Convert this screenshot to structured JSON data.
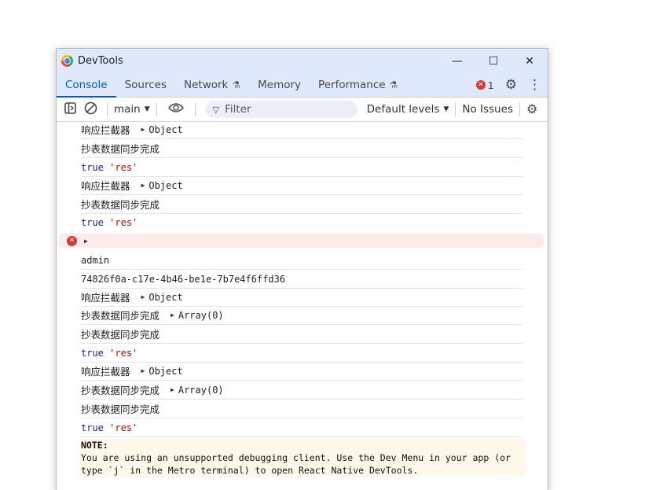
{
  "window": {
    "title": "DevTools"
  },
  "titlebar_buttons": {
    "minimize": "—",
    "maximize": "☐",
    "close": "✕"
  },
  "tabs": [
    {
      "label": "Console",
      "active": true,
      "experimental": false
    },
    {
      "label": "Sources",
      "active": false,
      "experimental": false
    },
    {
      "label": "Network",
      "active": false,
      "experimental": true
    },
    {
      "label": "Memory",
      "active": false,
      "experimental": false
    },
    {
      "label": "Performance",
      "active": false,
      "experimental": true
    }
  ],
  "error_count": "1",
  "toolbar": {
    "context": "main",
    "filter_placeholder": "Filter",
    "levels": "Default levels",
    "issues": "No Issues"
  },
  "log": [
    {
      "text": "响应拦截器",
      "object": "Object"
    },
    {
      "text": "抄表数据同步完成",
      "object": ""
    },
    {
      "kw": "true",
      "str": "'res'"
    },
    {
      "text": "响应拦截器",
      "object": "Object"
    },
    {
      "text": "抄表数据同步完成",
      "object": ""
    },
    {
      "kw": "true",
      "str": "'res'"
    },
    {
      "text": "admin"
    },
    {
      "text": "74826f0a-c17e-4b46-be1e-7b7e4f6ffd36"
    },
    {
      "text": "响应拦截器",
      "object": "Object"
    },
    {
      "text": "抄表数据同步完成",
      "object": "Array(0)"
    },
    {
      "text": "抄表数据同步完成",
      "object": ""
    },
    {
      "kw": "true",
      "str": "'res'"
    },
    {
      "text": "响应拦截器",
      "object": "Object"
    },
    {
      "text": "抄表数据同步完成",
      "object": "Array(0)"
    },
    {
      "text": "抄表数据同步完成",
      "object": ""
    },
    {
      "kw": "true",
      "str": "'res'"
    }
  ],
  "note": {
    "title": "NOTE:",
    "body": "You are using an unsupported debugging client. Use the Dev Menu in your app (or type `j` in the Metro terminal) to open React Native DevTools."
  },
  "colors": {
    "accent": "#0b57d0",
    "error": "#dc362e",
    "titlebar": "#dee9fb"
  }
}
